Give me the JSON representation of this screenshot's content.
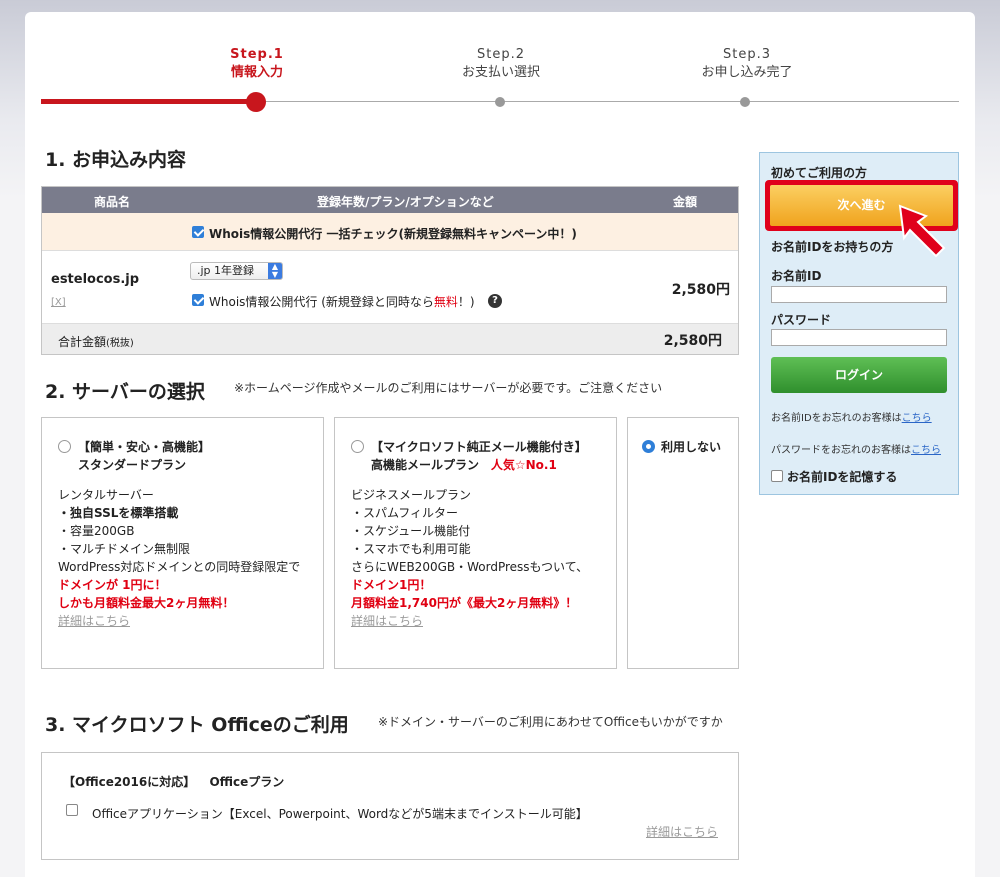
{
  "steps": [
    {
      "num": "Step.1",
      "label": "情報入力",
      "active": true
    },
    {
      "num": "Step.2",
      "label": "お支払い選択",
      "active": false
    },
    {
      "num": "Step.3",
      "label": "お申し込み完了",
      "active": false
    }
  ],
  "section1": {
    "title": "1. お申込み内容",
    "headers": {
      "name": "商品名",
      "options": "登録年数/プラン/オプションなど",
      "price": "金額"
    },
    "campaign_label": "Whois情報公開代行 一括チェック(新規登録無料キャンペーン中！)",
    "domain": "estelocos.jp",
    "remove": "[X]",
    "plan_select": ".jp 1年登録",
    "whois_label_pre": "Whois情報公開代行 (新規登録と同時なら",
    "whois_free": "無料",
    "whois_label_post": "！)",
    "help": "?",
    "price": "2,580円",
    "total_label": "合計金額",
    "total_tax": "(税抜)",
    "total_price": "2,580円"
  },
  "section2": {
    "title": "2. サーバーの選択",
    "note": "※ホームページ作成やメールのご利用にはサーバーが必要です。ご注意ください",
    "standard": {
      "tag": "【簡単・安心・高機能】",
      "name": "スタンダードプラン",
      "l1": "レンタルサーバー",
      "l2": "・独自SSLを標準搭載",
      "l3": "・容量200GB",
      "l4": "・マルチドメイン無制限",
      "l5": "WordPress対応ドメインとの同時登録限定で",
      "l6": "ドメインが 1円に！",
      "l7": "しかも月額料金最大2ヶ月無料！",
      "detail": "詳細はこちら"
    },
    "mail": {
      "tag": "【マイクロソフト純正メール機能付き】",
      "name": "高機能メールプラン",
      "badge": "人気☆No.1",
      "l1": "ビジネスメールプラン",
      "l2": "・スパムフィルター",
      "l3": "・スケジュール機能付",
      "l4": "・スマホでも利用可能",
      "l5": "さらにWEB200GB・WordPressもついて、",
      "l6": "ドメイン1円！",
      "l7": "月額料金1,740円が《最大2ヶ月無料》！",
      "detail": "詳細はこちら"
    },
    "none_label": "利用しない"
  },
  "section3": {
    "title": "3. マイクロソフト Officeのご利用",
    "note": "※ドメイン・サーバーのご利用にあわせてOfficeもいかがですか",
    "plan_tag": "【Office2016に対応】",
    "plan_name": "Officeプラン",
    "app_label": "Officeアプリケーション【Excel、Powerpoint、Wordなどが5端末までインストール可能】",
    "detail": "詳細はこちら"
  },
  "login": {
    "first_time": "初めてご利用の方",
    "next": "次へ進む",
    "has_id": "お名前IDをお持ちの方",
    "id_label": "お名前ID",
    "pw_label": "パスワード",
    "login": "ログイン",
    "forgot_id_pre": "お名前IDをお忘れのお客様は",
    "forgot_id_link": "こちら",
    "forgot_pw_pre": "パスワードをお忘れのお客様は",
    "forgot_pw_link": "こちら",
    "remember": "お名前IDを記憶する"
  },
  "colors": {
    "accent": "#c8161d",
    "orange": "#f0a31d",
    "green": "#3a9b36",
    "blue": "#2f7fd8"
  }
}
